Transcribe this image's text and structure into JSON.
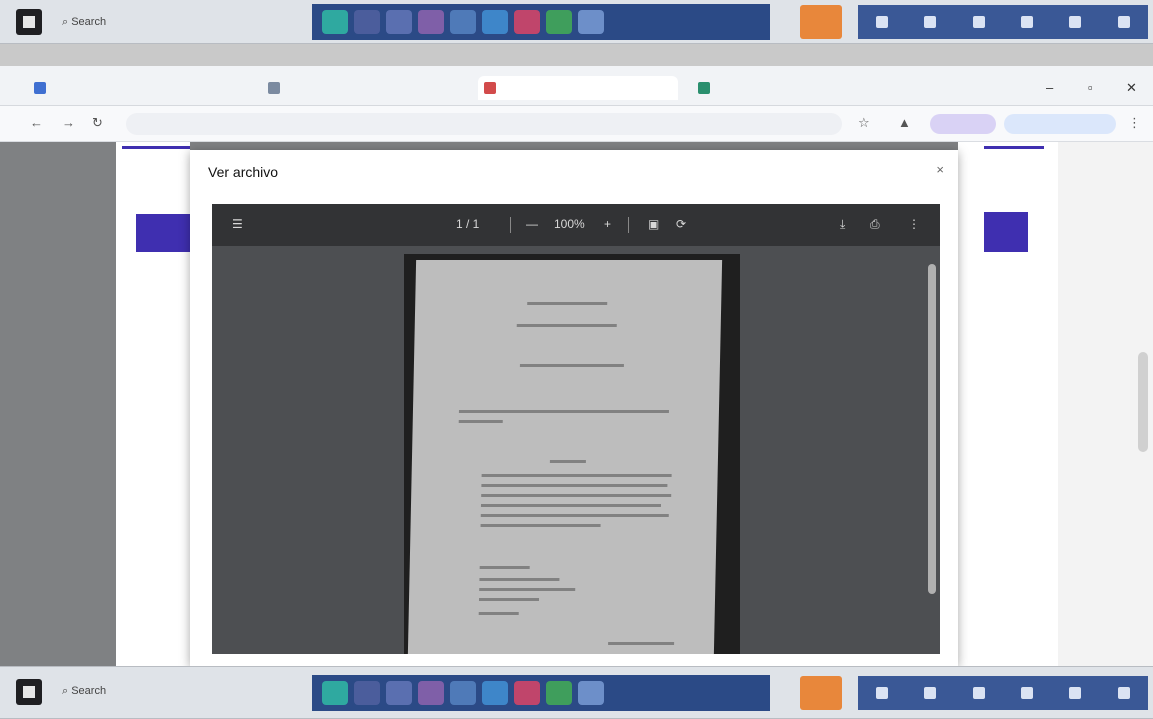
{
  "taskbar_top": {
    "search_label": "Search"
  },
  "taskbar_bottom": {
    "search_label": "Search"
  },
  "modal": {
    "title": "Ver archivo",
    "close_label": "×"
  },
  "viewer": {
    "menu_icon": "menu-icon",
    "page_counter": "1 / 1",
    "zoom_out": "—",
    "zoom_level": "100%",
    "zoom_in": "+",
    "download_icon": "download-icon",
    "print_icon": "print-icon",
    "more_icon": "more-icon"
  }
}
